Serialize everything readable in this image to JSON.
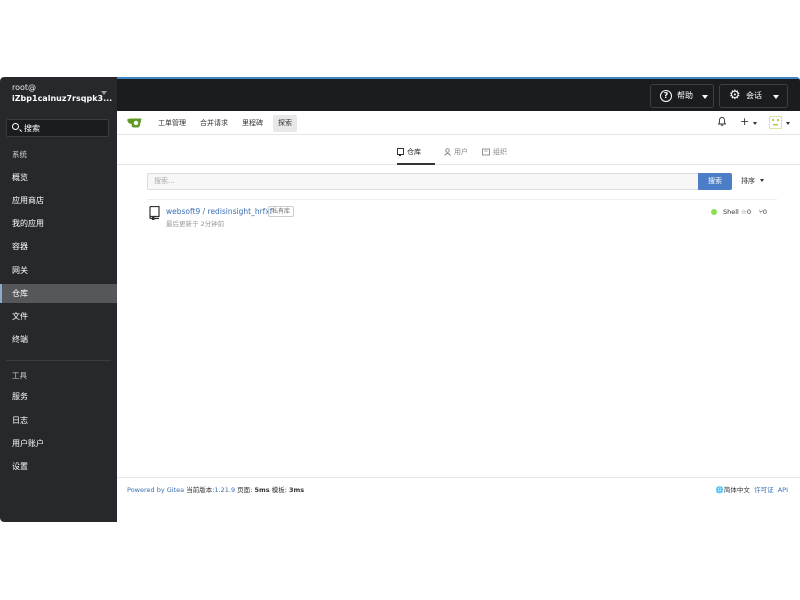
{
  "sidebar": {
    "user_name": "root@",
    "user_id": "iZbp1calnuz7rsqpk3...",
    "search_label": "搜索",
    "section_system": "系统",
    "items_system": [
      "概览",
      "应用商店",
      "我的应用",
      "容器",
      "网关",
      "仓库",
      "文件",
      "终端"
    ],
    "section_tools": "工具",
    "items_tools": [
      "服务",
      "日志",
      "用户账户",
      "设置"
    ],
    "active": "仓库"
  },
  "topbar": {
    "help_label": "帮助",
    "session_label": "会话",
    "accent": "#3d85c6"
  },
  "gitea_nav": {
    "items": [
      "工单管理",
      "合并请求",
      "里程碑",
      "探索"
    ],
    "active": "探索"
  },
  "explore": {
    "tabs": [
      {
        "label": "仓库",
        "icon": "repo-icon"
      },
      {
        "label": "用户",
        "icon": "user-icon"
      },
      {
        "label": "组织",
        "icon": "org-icon"
      }
    ],
    "active_tab": "仓库",
    "search_placeholder": "搜索...",
    "search_button": "搜索",
    "sort_label": "排序"
  },
  "repos": [
    {
      "name": "websoft9 / redisinsight_hrfxf",
      "badge": "私有库",
      "updated": "最后更新于 2分钟前",
      "language": "Shell",
      "language_color": "#89e051",
      "stars": "0",
      "forks": "0"
    }
  ],
  "footer": {
    "powered": "Powered by Gitea",
    "version_label": "当前版本:",
    "version": "1.21.9",
    "page_label": "页面:",
    "page_time": "5ms",
    "template_label": "模板:",
    "template_time": "3ms",
    "language": "简体中文",
    "license": "许可证",
    "api": "API"
  }
}
